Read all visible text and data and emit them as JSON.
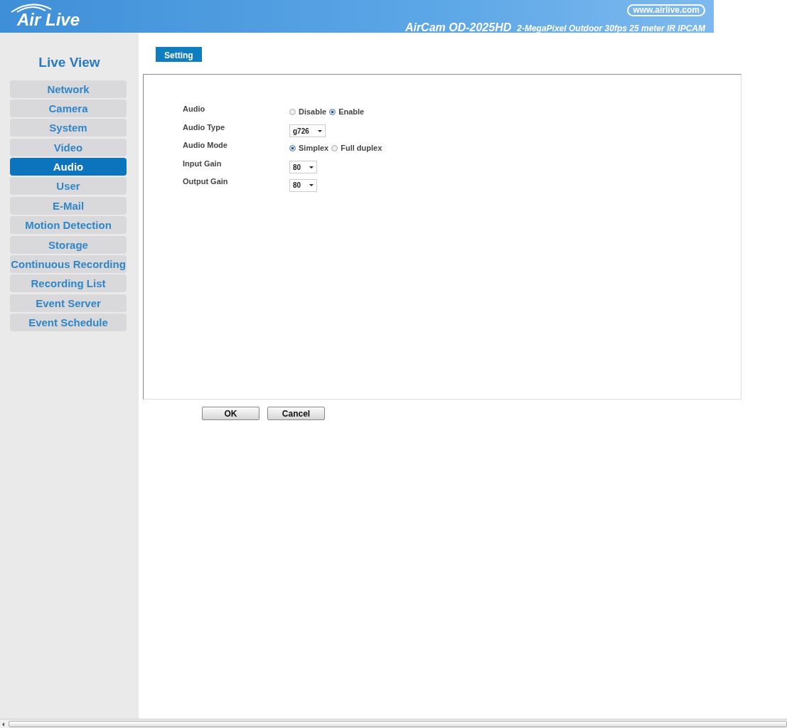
{
  "header": {
    "logo": "Air Live",
    "website": "www.airlive.com",
    "model": "AirCam OD-2025HD",
    "description": "2-MegaPixel Outdoor 30fps 25 meter IR IPCAM"
  },
  "sidebar": {
    "title": "Live View",
    "items": [
      {
        "label": "Network",
        "selected": false
      },
      {
        "label": "Camera",
        "selected": false
      },
      {
        "label": "System",
        "selected": false
      },
      {
        "label": "Video",
        "selected": false
      },
      {
        "label": "Audio",
        "selected": true
      },
      {
        "label": "User",
        "selected": false
      },
      {
        "label": "E-Mail",
        "selected": false
      },
      {
        "label": "Motion Detection",
        "selected": false
      },
      {
        "label": "Storage",
        "selected": false
      },
      {
        "label": "Continuous Recording",
        "selected": false
      },
      {
        "label": "Recording List",
        "selected": false
      },
      {
        "label": "Event Server",
        "selected": false
      },
      {
        "label": "Event Schedule",
        "selected": false
      }
    ]
  },
  "tabs": [
    {
      "label": "Setting",
      "selected": true
    }
  ],
  "form": [
    {
      "label": "Audio",
      "kind": "radio",
      "options": [
        {
          "label": "Disable",
          "selected": false
        },
        {
          "label": "Enable",
          "selected": true
        }
      ]
    },
    {
      "label": "Audio Type",
      "kind": "select",
      "value": "g726"
    },
    {
      "label": "Audio Mode",
      "kind": "radio",
      "options": [
        {
          "label": "Simplex",
          "selected": true
        },
        {
          "label": "Full duplex",
          "selected": false
        }
      ]
    },
    {
      "label": "Input Gain",
      "kind": "select",
      "value": "80"
    },
    {
      "label": "Output Gain",
      "kind": "select",
      "value": "80"
    }
  ],
  "buttons": [
    "OK",
    "Cancel"
  ]
}
